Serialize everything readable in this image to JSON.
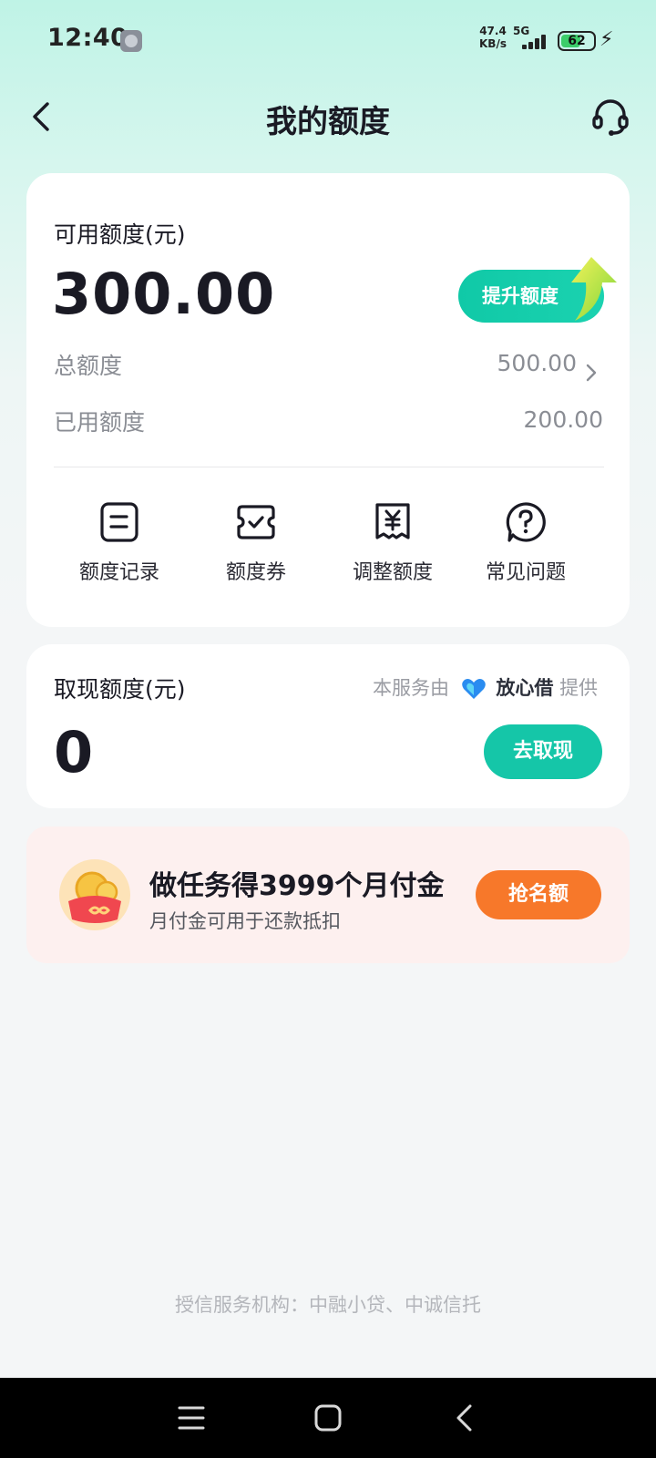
{
  "status_bar": {
    "time": "12:40",
    "net_speed_value": "47.4",
    "net_speed_unit": "KB/s",
    "net_type": "5G",
    "battery": "62",
    "battery_level": 0.62
  },
  "header": {
    "title": "我的额度",
    "back_icon": "chevron-left-icon",
    "support_icon": "headset-icon"
  },
  "credit": {
    "available_label": "可用额度(元)",
    "available_amount": "300.00",
    "boost_button": "提升额度",
    "total_label": "总额度",
    "total_value": "500.00",
    "used_label": "已用额度",
    "used_value": "200.00",
    "actions": [
      {
        "label": "额度记录",
        "icon": "record-icon"
      },
      {
        "label": "额度券",
        "icon": "coupon-icon"
      },
      {
        "label": "调整额度",
        "icon": "yuan-icon"
      },
      {
        "label": "常见问题",
        "icon": "question-icon"
      }
    ]
  },
  "withdraw": {
    "label": "取现额度(元)",
    "provider_prefix": "本服务由",
    "provider_name": "放心借",
    "provider_suffix": "提供",
    "amount": "0",
    "button": "去取现"
  },
  "promo": {
    "title": "做任务得3999个月付金",
    "subtitle": "月付金可用于还款抵扣",
    "button": "抢名额"
  },
  "footer": {
    "institution": "授信服务机构：中融小贷、中诚信托"
  },
  "colors": {
    "accent": "#15c6a8",
    "promo_button": "#f7782a",
    "promo_bg": "#fdf0ef"
  }
}
